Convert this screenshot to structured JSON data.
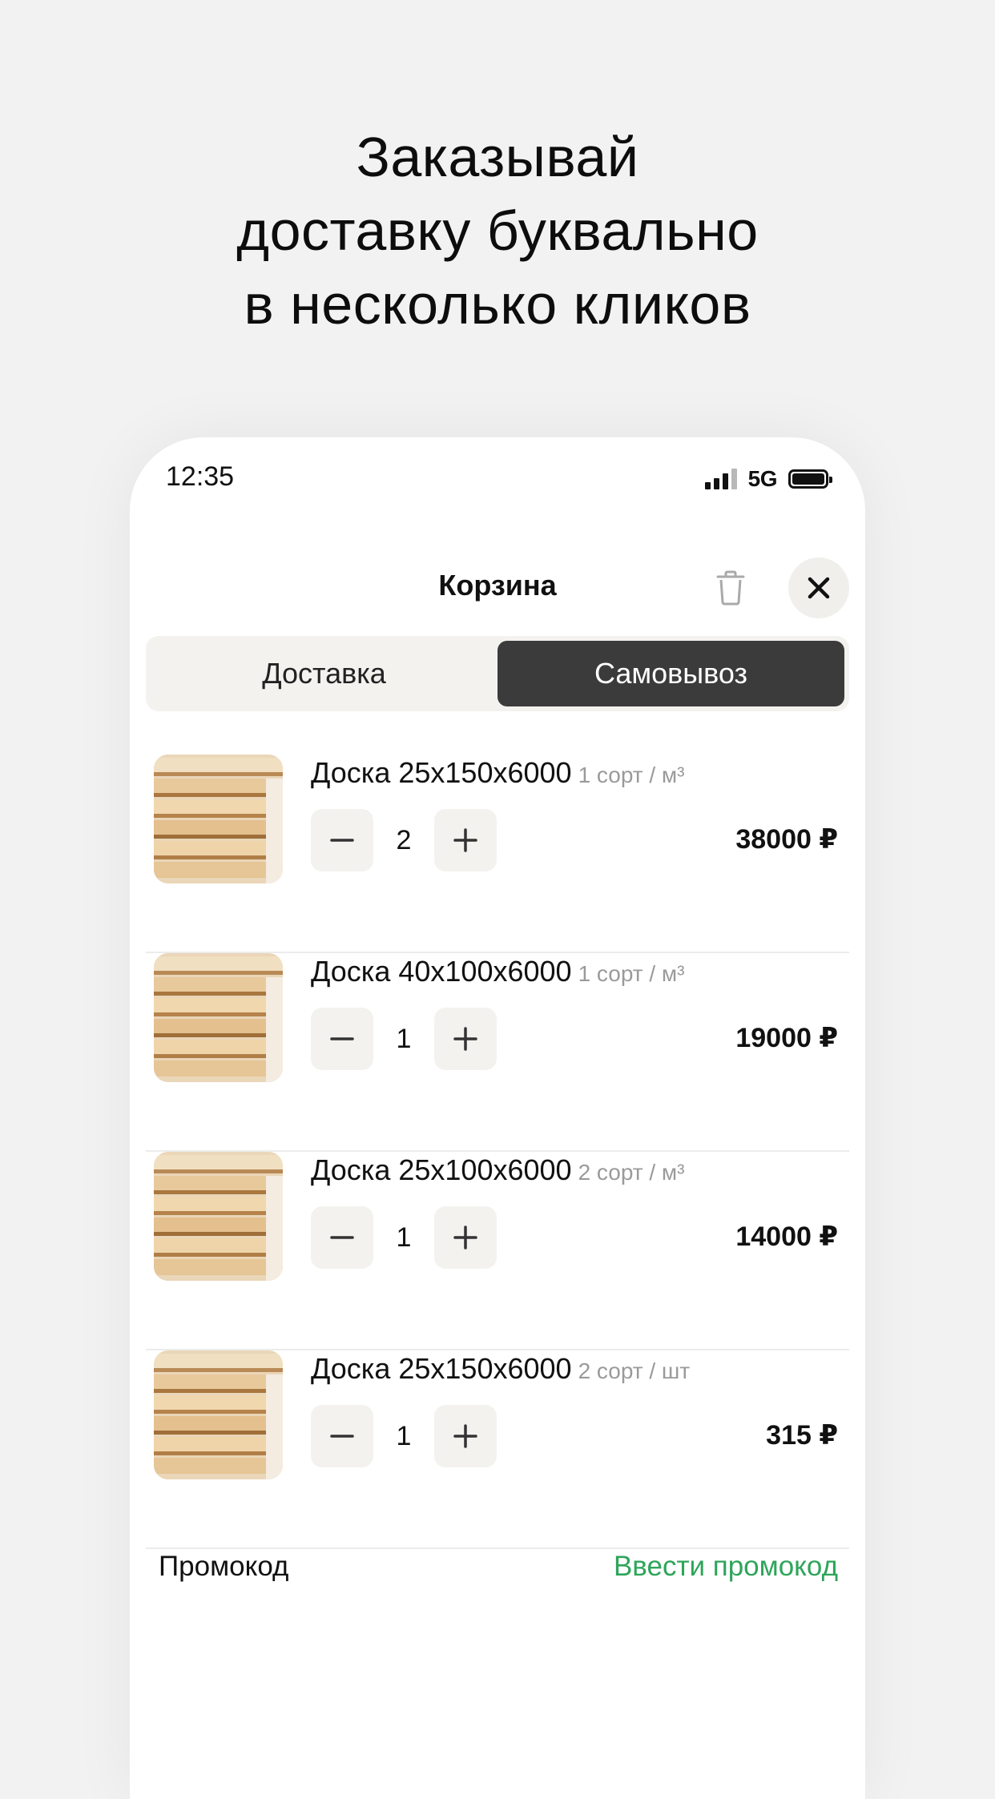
{
  "headline": {
    "line1": "Заказывай",
    "line2": "доставку буквально",
    "line3": "в несколько кликов"
  },
  "status_bar": {
    "time": "12:35",
    "network": "5G"
  },
  "header": {
    "title": "Корзина",
    "trash_icon": "trash-icon",
    "close_icon": "close-icon"
  },
  "tabs": [
    {
      "label": "Доставка",
      "active": false
    },
    {
      "label": "Самовывоз",
      "active": true
    }
  ],
  "items": [
    {
      "name": "Доска 25x150x6000",
      "grade": "1 сорт / м³",
      "qty": "2",
      "price": "38000 ₽"
    },
    {
      "name": "Доска 40x100x6000",
      "grade": "1 сорт / м³",
      "qty": "1",
      "price": "19000 ₽"
    },
    {
      "name": "Доска 25x100x6000",
      "grade": "2 сорт / м³",
      "qty": "1",
      "price": "14000 ₽"
    },
    {
      "name": "Доска 25x150x6000",
      "grade": "2 сорт / шт",
      "qty": "1",
      "price": "315 ₽"
    }
  ],
  "promo": {
    "label": "Промокод",
    "link": "Ввести промокод"
  },
  "colors": {
    "accent_green": "#2ea55a",
    "active_tab": "#3b3b3b",
    "control_bg": "#f3f2ef"
  }
}
